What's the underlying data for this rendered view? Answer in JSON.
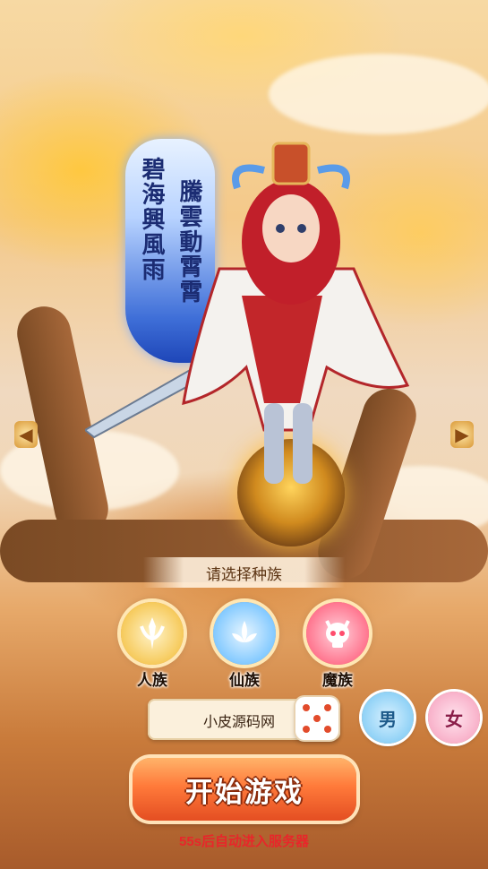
{
  "banner": {
    "line_right": "碧海興風雨",
    "line_left": "騰雲動霄霄"
  },
  "race_select": {
    "title": "请选择种族",
    "races": [
      {
        "label": "人族",
        "icon": "human-race-icon",
        "color": "#f2b82c",
        "selected": true
      },
      {
        "label": "仙族",
        "icon": "lotus-icon",
        "color": "#57b6ff",
        "selected": false
      },
      {
        "label": "魔族",
        "icon": "skull-icon",
        "color": "#ff4d6d",
        "selected": false
      }
    ]
  },
  "name": {
    "value": "小皮源码网"
  },
  "gender": {
    "male": "男",
    "female": "女"
  },
  "start_button": {
    "label": "开始游戏"
  },
  "countdown": {
    "text": "55s后自动进入服务器"
  },
  "colors": {
    "accent": "#ff7a3a",
    "countdown": "#e8262a"
  }
}
